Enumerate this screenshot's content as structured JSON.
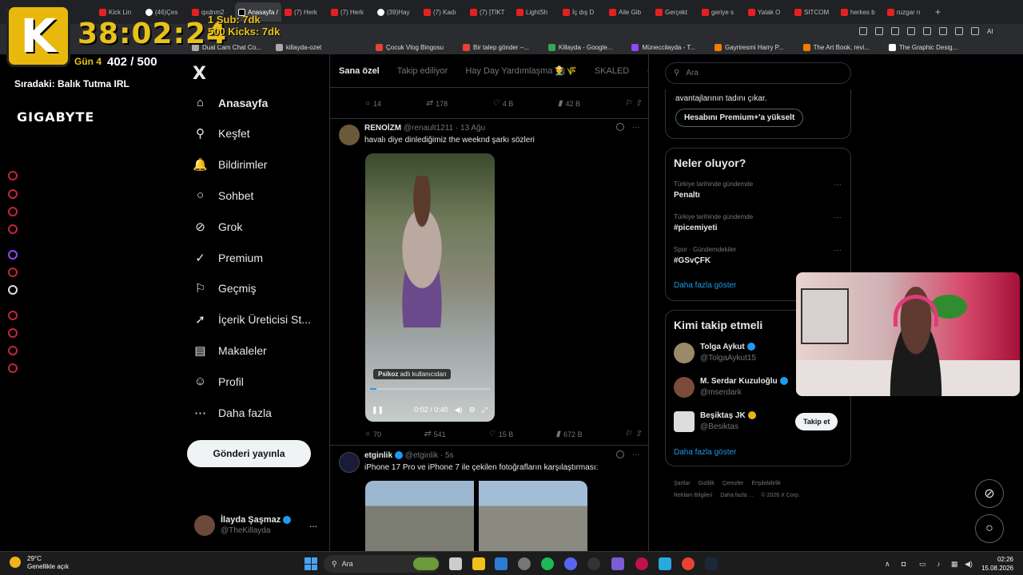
{
  "browser": {
    "tabs": [
      {
        "label": "",
        "kind": "red"
      },
      {
        "label": "",
        "kind": "red"
      },
      {
        "label": "Kick Lin",
        "kind": "red"
      },
      {
        "label": "(46)Çes",
        "kind": "tk"
      },
      {
        "label": "qxdnm2",
        "kind": "red"
      },
      {
        "label": "Anasayfa /",
        "kind": "x",
        "active": true
      },
      {
        "label": "(7) Herk",
        "kind": "red"
      },
      {
        "label": "(7) Herk",
        "kind": "red"
      },
      {
        "label": "(39)Hay",
        "kind": "tk"
      },
      {
        "label": "(7) Kadı",
        "kind": "red"
      },
      {
        "label": "(7) [TİKT",
        "kind": "red"
      },
      {
        "label": "LightSh",
        "kind": "red"
      },
      {
        "label": "İç dış D",
        "kind": "red"
      },
      {
        "label": "Aile Gib",
        "kind": "red"
      },
      {
        "label": "Gerçekt",
        "kind": "red"
      },
      {
        "label": "geriye s",
        "kind": "red"
      },
      {
        "label": "Yatak O",
        "kind": "red"
      },
      {
        "label": "SITCOM",
        "kind": "red"
      },
      {
        "label": "herkes b",
        "kind": "red"
      },
      {
        "label": "ruzgar n",
        "kind": "red"
      }
    ],
    "bookmarks": [
      "Çocuk Vlog Bingosu",
      "Bir talep gönder –...",
      "Killayda - Google...",
      "Müneccilayda - T...",
      "Gayriresmi Harry P...",
      "The Art Book, revi...",
      "The Graphic Desig..."
    ],
    "bookmarks_left": [
      "Dual Cam Chat Co...",
      "killayda-ozet"
    ],
    "toolbar_ai": "AI"
  },
  "stream_overlay": {
    "logo_letter": "K",
    "timer": "38:02:24",
    "sub_rate": "1 Sub: 7dk",
    "kicks_rate": "500 Kicks: 7dk",
    "day_label": "Gün 4",
    "day_value": "402 / 500",
    "next_label": "Sıradaki: Balık Tutma IRL",
    "sponsor": "GIGABYTE"
  },
  "sidebar": {
    "logo": "X",
    "items": [
      {
        "label": "Anasayfa",
        "icon": "home-icon",
        "glyph": "⌂"
      },
      {
        "label": "Keşfet",
        "icon": "search-icon",
        "glyph": "⚲"
      },
      {
        "label": "Bildirimler",
        "icon": "bell-icon",
        "glyph": "🔔"
      },
      {
        "label": "Sohbet",
        "icon": "chat-icon",
        "glyph": "○"
      },
      {
        "label": "Grok",
        "icon": "grok-icon",
        "glyph": "⊘"
      },
      {
        "label": "Premium",
        "icon": "premium-icon",
        "glyph": "✓"
      },
      {
        "label": "Geçmiş",
        "icon": "bookmark-icon",
        "glyph": "⚐"
      },
      {
        "label": "İçerik Üreticisi St...",
        "icon": "rocket-icon",
        "glyph": "➚"
      },
      {
        "label": "Makaleler",
        "icon": "article-icon",
        "glyph": "▤"
      },
      {
        "label": "Profil",
        "icon": "profile-icon",
        "glyph": "☺"
      },
      {
        "label": "Daha fazla",
        "icon": "more-icon",
        "glyph": "⋯"
      }
    ],
    "post_button": "Gönderi yayınla",
    "account": {
      "name": "İlayda Şaşmaz",
      "handle": "@TheKillayda",
      "more": "..."
    }
  },
  "timeline": {
    "tabs": [
      "Sana özel",
      "Takip ediliyor",
      "Hay Day Yardımlaşma 👨‍🌾🌾",
      "SKALED"
    ],
    "add_tab": "+",
    "prev_tweet_stats": {
      "replies": "14",
      "reposts": "178",
      "likes": "4 B",
      "views": "42 B"
    },
    "tweets": [
      {
        "name": "RENOİZM",
        "handle": "@renault1211",
        "time": "· 13 Ağu",
        "text": "havalı diye dinlediğimiz the weeknd şarkı sözleri",
        "video": {
          "credit_name": "Psikoz",
          "credit_suffix": "adlı kullanıcıdan",
          "time": "0:02 / 0:40",
          "progress": 0.05
        },
        "stats": {
          "replies": "70",
          "reposts": "541",
          "likes": "15 B",
          "views": "672 B"
        }
      },
      {
        "name": "etginlik",
        "handle": "@etginlik",
        "time": "· 5s",
        "text": "iPhone 17 Pro ve iPhone 7 ile çekilen fotoğrafların karşılaştırması:"
      }
    ]
  },
  "right": {
    "search_placeholder": "Ara",
    "premium_text": "avantajlarının tadını çıkar.",
    "premium_button": "Hesabını Premium+'a yükselt",
    "trends_title": "Neler oluyor?",
    "trends": [
      {
        "category": "Türkiye tarihinde gündemde",
        "title": "Penaltı"
      },
      {
        "category": "Türkiye tarihinde gündemde",
        "title": "#picemiyeti"
      },
      {
        "category": "Spor · Gündemdekiler",
        "title": "#GSvÇFK"
      }
    ],
    "show_more": "Daha fazla göster",
    "who_title": "Kimi takip etmeli",
    "who": [
      {
        "name": "Tolga Aykut",
        "handle": "@TolgaAykut15",
        "badge": "blue"
      },
      {
        "name": "M. Serdar Kuzuloğlu",
        "handle": "@mserdark",
        "badge": "blue"
      },
      {
        "name": "Beşiktaş JK",
        "handle": "@Besiktas",
        "badge": "gold",
        "follow": "Takip et"
      }
    ],
    "who_more": "Daha fazla göster",
    "footer": [
      "Şartlar",
      "Gizlilik",
      "Çerezler",
      "Erişilebilirlik",
      "Reklam Bilgileri",
      "Daha fazla ...",
      "© 2026 X Corp."
    ]
  },
  "taskbar": {
    "weather_temp": "29°C",
    "weather_desc": "Genellikle açık",
    "search_placeholder": "Ara",
    "time": "02:26",
    "date": "15.08.2026"
  },
  "colors": {
    "accent": "#1d9bf0",
    "overlay_yellow": "#e8c21a",
    "background": "#000000"
  }
}
